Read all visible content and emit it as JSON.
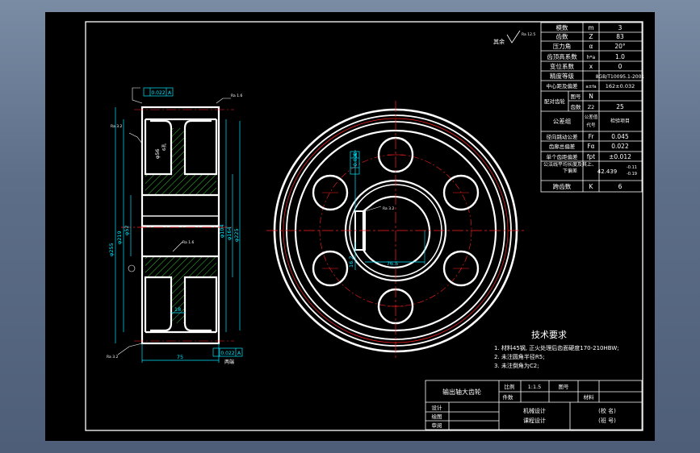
{
  "drawing": {
    "background": "#000000",
    "outer_bg": "#6b7c96",
    "colors": {
      "line": "#ffffff",
      "dim": "#00e5ff",
      "center": "#ff2020",
      "hatch": "#38d838",
      "text": "#ffffff"
    }
  },
  "title_block": {
    "part_name": "输出轴大齿轮",
    "ratio_label": "比例",
    "ratio_value": "1:1.5",
    "count_label": "件数",
    "material_label": "材料",
    "drawing_no_label": "图号",
    "designer_label": "设计",
    "drafter_label": "绘图",
    "checker_label": "审阅",
    "course_line1": "机械设计",
    "course_line2": "课程设计",
    "school_line1": "(校 名)",
    "school_line2": "(班 号)"
  },
  "tech_requirements": {
    "title": "技术要求",
    "items": [
      "1. 材料45钢, 正火处理后齿面硬度170-210HBW;",
      "2. 未注圆角半径R5;",
      "3. 未注倒角为C2;"
    ]
  },
  "param_table": {
    "rows": [
      {
        "name": "模数",
        "sym": "m",
        "val": "3"
      },
      {
        "name": "齿数",
        "sym": "Z",
        "val": "83"
      },
      {
        "name": "压力角",
        "sym": "α",
        "val": "20°"
      },
      {
        "name": "齿顶高系数",
        "sym": "h*a",
        "val": "1.0"
      },
      {
        "name": "变位系数",
        "sym": "x",
        "val": "0"
      },
      {
        "name": "精度等级",
        "sym": "",
        "val": "8GB/T10095.1-2001"
      },
      {
        "name": "中心距及偏差",
        "sym": "a±fa",
        "val": "162±0.032"
      },
      {
        "name": "配对齿轮",
        "sym": "图号",
        "val": ""
      },
      {
        "name": "",
        "sym": "齿数",
        "val": "25"
      },
      {
        "name": "公差组",
        "sym": "",
        "val": "检验项目"
      },
      {
        "name": "径向跳动公差",
        "sym": "Fr",
        "val": "0.045"
      },
      {
        "name": "齿廓总偏差",
        "sym": "Fα",
        "val": "0.022"
      },
      {
        "name": "单个齿距偏差",
        "sym": "fpt",
        "val": "±0.012"
      },
      {
        "name": "公法线平均长度及其上、下偏差",
        "sym": "",
        "val": "42.439"
      },
      {
        "name": "跨齿数",
        "sym": "K",
        "val": "6"
      }
    ],
    "pair_sym": "N",
    "pair_teeth_sym": "Z2",
    "tol_sub1": "公差值",
    "tol_sub2": "代号",
    "wk_dev_top": "-0.11",
    "wk_dev_bottom": "-0.19"
  },
  "roughness": {
    "label": "其余",
    "value": "Ra 12.5"
  },
  "side_view": {
    "dims": {
      "total_width": "75",
      "web": "18",
      "tip_dia": "φ255",
      "hub_dia": "φ219",
      "bore_dia": "φ52",
      "d1": "φ164",
      "d2": "φ104",
      "d3": "φ225",
      "hole": "φ56",
      "hole_tag": "6孔"
    },
    "runout_top_val": "0.022",
    "runout_top_datum": "A",
    "runout_bottom_val": "0.022",
    "runout_bottom_datum": "A",
    "ra_labels": [
      "Ra 1.6",
      "Ra 3.2",
      "Ra 1.6",
      "Ra 3.2"
    ],
    "note_bottom": "两端"
  },
  "front_view": {
    "key_width": "16.2",
    "keyway_depth": "76.5",
    "keyway_ra": "Ra 3.2",
    "keyway_tol": "0.022",
    "keyway_datum": "A"
  }
}
